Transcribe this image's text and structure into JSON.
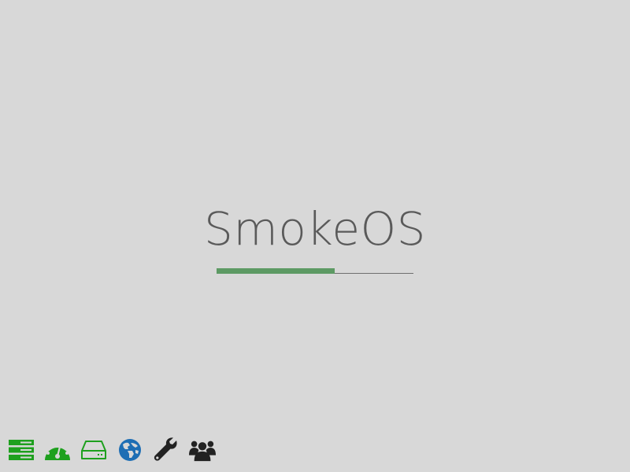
{
  "splash": {
    "title": "SmokeOS",
    "progress": 0.6,
    "progress_color": "#5d9a64",
    "title_color": "#5a5a5a"
  },
  "taskbar": {
    "icons": [
      {
        "name": "server-icon",
        "color": "#1ea01e"
      },
      {
        "name": "dashboard-gauge-icon",
        "color": "#1ea01e"
      },
      {
        "name": "hard-drive-icon",
        "color": "#1ea01e"
      },
      {
        "name": "globe-icon",
        "color": "#1e6eb4"
      },
      {
        "name": "wrench-icon",
        "color": "#222222"
      },
      {
        "name": "users-group-icon",
        "color": "#222222"
      }
    ]
  }
}
